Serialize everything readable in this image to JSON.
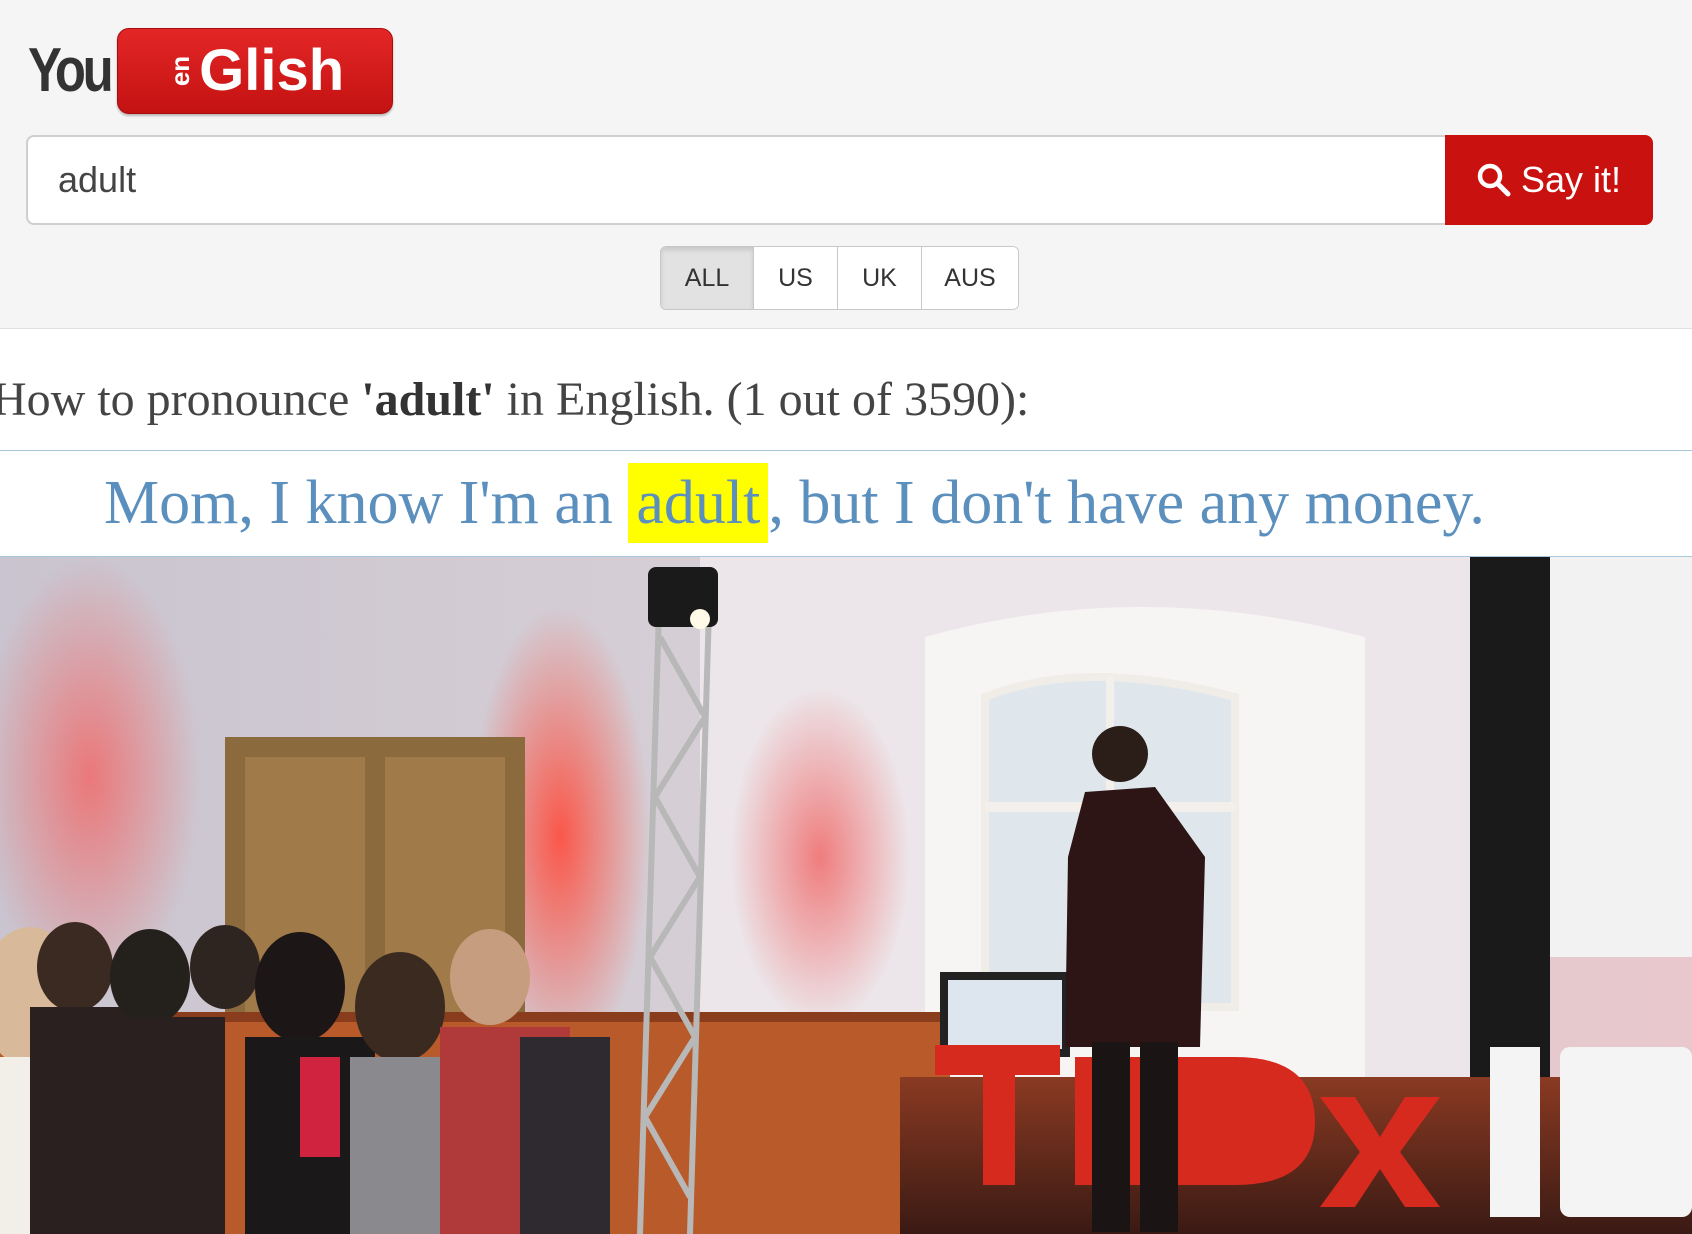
{
  "logo": {
    "you": "You",
    "en": "en",
    "glish": "Glish"
  },
  "search": {
    "value": "adult",
    "button_label": "Say it!"
  },
  "accents": [
    {
      "label": "ALL",
      "active": true
    },
    {
      "label": "US",
      "active": false
    },
    {
      "label": "UK",
      "active": false
    },
    {
      "label": "AUS",
      "active": false
    }
  ],
  "heading": {
    "prefix": "How to pronounce ",
    "word": "'adult'",
    "suffix": " in English. (1 out of 3590):"
  },
  "caption": {
    "before": "Mom, I know I'm an ",
    "highlight": "adult",
    "after": ", but I don't have any money."
  },
  "video": {
    "stage_letters": "TEDxUB"
  },
  "colors": {
    "brand_red": "#c9110f",
    "caption_blue": "#5b8fbd",
    "highlight_yellow": "#ffff00"
  }
}
